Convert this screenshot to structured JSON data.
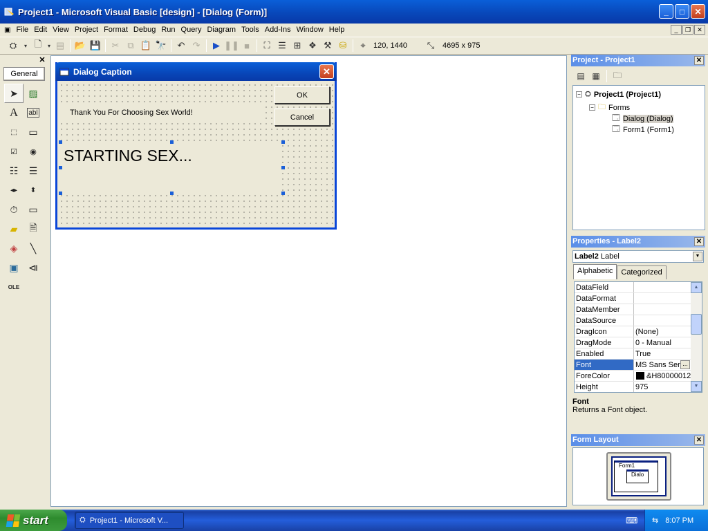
{
  "window": {
    "title": "Project1 - Microsoft Visual Basic [design] - [Dialog (Form)]",
    "icons": {
      "app": "vb-ide-icon",
      "minimize": "minimize-icon",
      "maximize": "maximize-icon",
      "close": "close-icon"
    }
  },
  "menu": [
    "File",
    "Edit",
    "View",
    "Project",
    "Format",
    "Debug",
    "Run",
    "Query",
    "Diagram",
    "Tools",
    "Add-Ins",
    "Window",
    "Help"
  ],
  "toolbar": {
    "position_readout": "120, 1440",
    "size_readout": "4695 x 975"
  },
  "toolbox": {
    "tab_label": "General",
    "tools": [
      "pointer",
      "picturebox",
      "label",
      "textbox",
      "frame",
      "commandbutton",
      "checkbox",
      "optionbutton",
      "combobox",
      "listbox",
      "hscrollbar",
      "vscrollbar",
      "timer",
      "drivelistbox",
      "dirlistbox",
      "filelistbox",
      "shape",
      "line",
      "image",
      "data",
      "ole"
    ]
  },
  "dialog": {
    "caption": "Dialog Caption",
    "ok_label": "OK",
    "cancel_label": "Cancel",
    "label1_text": "Thank You For Choosing Sex World!",
    "label2_text": "STARTING SEX..."
  },
  "project_panel": {
    "title": "Project - Project1",
    "tree": {
      "root": "Project1 (Project1)",
      "folder": "Forms",
      "items": [
        "Dialog (Dialog)",
        "Form1 (Form1)"
      ]
    }
  },
  "properties_panel": {
    "title": "Properties - Label2",
    "object_name": "Label2",
    "object_type": "Label",
    "tabs": [
      "Alphabetic",
      "Categorized"
    ],
    "rows": [
      {
        "name": "DataField",
        "value": ""
      },
      {
        "name": "DataFormat",
        "value": ""
      },
      {
        "name": "DataMember",
        "value": ""
      },
      {
        "name": "DataSource",
        "value": ""
      },
      {
        "name": "DragIcon",
        "value": "(None)"
      },
      {
        "name": "DragMode",
        "value": "0 - Manual"
      },
      {
        "name": "Enabled",
        "value": "True"
      },
      {
        "name": "Font",
        "value": "MS Sans Seri..."
      },
      {
        "name": "ForeColor",
        "value": "&H80000012"
      },
      {
        "name": "Height",
        "value": "975"
      }
    ],
    "selected_row": "Font",
    "description_name": "Font",
    "description_text": "Returns a Font object."
  },
  "form_layout_panel": {
    "title": "Form Layout",
    "mini_form1": "Form1",
    "mini_dialog": "Dialo"
  },
  "taskbar": {
    "start_label": "start",
    "task_label": "Project1 - Microsoft V...",
    "clock": "8:07 PM"
  },
  "colors": {
    "titlebar": "#0846b8",
    "accent": "#316ac5",
    "selection_handle": "#1a5fd8"
  }
}
